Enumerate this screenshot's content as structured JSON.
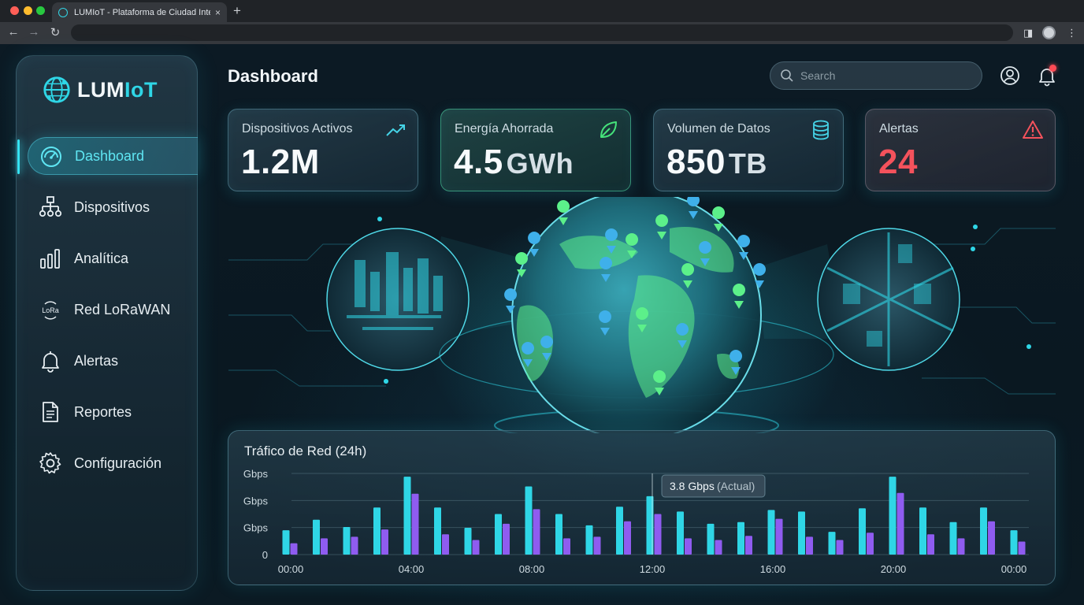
{
  "browser": {
    "tab_title": "LUMIoT - Plataforma de Ciudad Inteligente",
    "tab_close": "×",
    "new_tab": "+"
  },
  "sidebar": {
    "logo_main": "LUM",
    "logo_accent": "IoT",
    "items": [
      {
        "label": "Dashboard",
        "icon": "gauge-icon",
        "active": true
      },
      {
        "label": "Dispositivos",
        "icon": "network-tree-icon"
      },
      {
        "label": "Analítica",
        "icon": "bar-chart-icon"
      },
      {
        "label": "Red LoRaWAN",
        "icon": "lora-icon"
      },
      {
        "label": "Alertas",
        "icon": "bell-icon"
      },
      {
        "label": "Reportes",
        "icon": "document-icon"
      },
      {
        "label": "Configuración",
        "icon": "gear-icon"
      }
    ]
  },
  "header": {
    "title": "Dashboard",
    "search_placeholder": "Search"
  },
  "cards": [
    {
      "label": "Dispositivos Activos",
      "value": "1.2M",
      "unit": "",
      "icon": "trending-up-icon"
    },
    {
      "label": "Energía Ahorrada",
      "value": "4.5",
      "unit": "GWh",
      "icon": "leaf-icon"
    },
    {
      "label": "Volumen de Datos",
      "value": "850",
      "unit": "TB",
      "icon": "database-icon"
    },
    {
      "label": "Alertas",
      "value": "24",
      "unit": "",
      "icon": "warning-icon"
    }
  ],
  "colors": {
    "accent": "#2fd6e6",
    "purple": "#8f5cf0",
    "alert": "#f4525c",
    "green": "#45e27a"
  },
  "chart_data": {
    "type": "bar",
    "title": "Tráfico de Red (24h)",
    "y_tick_labels": [
      "Gbps",
      "Gbps",
      "Gbps",
      "0"
    ],
    "x_tick_labels": [
      "00:00",
      "04:00",
      "08:00",
      "12:00",
      "16:00",
      "20:00",
      "00:00"
    ],
    "tooltip_value": "3.8 Gbps",
    "tooltip_note": "(Actual)",
    "grid": true,
    "ylim": [
      0,
      100
    ],
    "series": [
      {
        "values": [
          30,
          43,
          34,
          58,
          96,
          58,
          33,
          50,
          84,
          50,
          36,
          59,
          72,
          53,
          38,
          40,
          55,
          53,
          28,
          57,
          96,
          58,
          40,
          58,
          30
        ]
      },
      {
        "values": [
          14,
          20,
          22,
          31,
          75,
          25,
          18,
          38,
          56,
          20,
          22,
          41,
          50,
          20,
          18,
          23,
          44,
          22,
          18,
          27,
          76,
          25,
          20,
          41,
          16
        ]
      }
    ]
  }
}
